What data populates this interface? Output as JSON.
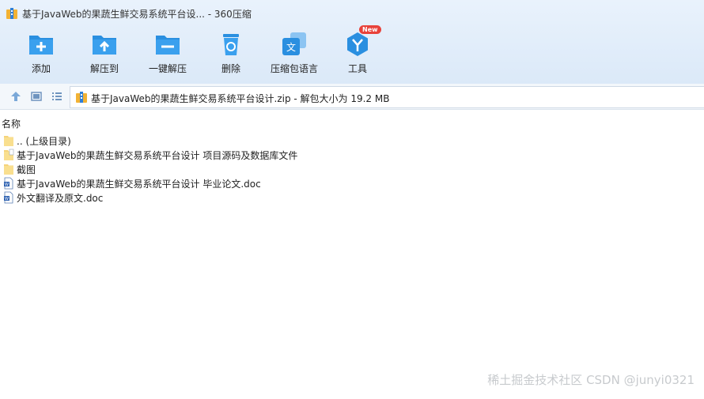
{
  "window": {
    "title": "基于JavaWeb的果蔬生鲜交易系统平台设... - 360压缩"
  },
  "toolbar": {
    "items": [
      {
        "label": "添加",
        "icon": "add-folder-icon"
      },
      {
        "label": "解压到",
        "icon": "extract-to-icon"
      },
      {
        "label": "一键解压",
        "icon": "one-click-extract-icon"
      },
      {
        "label": "删除",
        "icon": "recycle-bin-icon"
      },
      {
        "label": "压缩包语言",
        "icon": "archive-language-icon"
      },
      {
        "label": "工具",
        "icon": "tools-icon",
        "badge": "New"
      }
    ]
  },
  "address": {
    "text": "基于JavaWeb的果蔬生鲜交易系统平台设计.zip - 解包大小为 19.2 MB"
  },
  "list": {
    "column_name": "名称",
    "rows": [
      {
        "name": ".. (上级目录)",
        "type": "folder"
      },
      {
        "name": "基于JavaWeb的果蔬生鲜交易系统平台设计 项目源码及数据库文件",
        "type": "folder-file"
      },
      {
        "name": "截图",
        "type": "folder"
      },
      {
        "name": "基于JavaWeb的果蔬生鲜交易系统平台设计 毕业论文.doc",
        "type": "doc"
      },
      {
        "name": "外文翻译及原文.doc",
        "type": "doc"
      }
    ]
  },
  "watermark": "稀土掘金技术社区 CSDN @junyi0321",
  "colors": {
    "accent": "#2a8fe0",
    "toolbar_bg": "#e2edf9"
  }
}
